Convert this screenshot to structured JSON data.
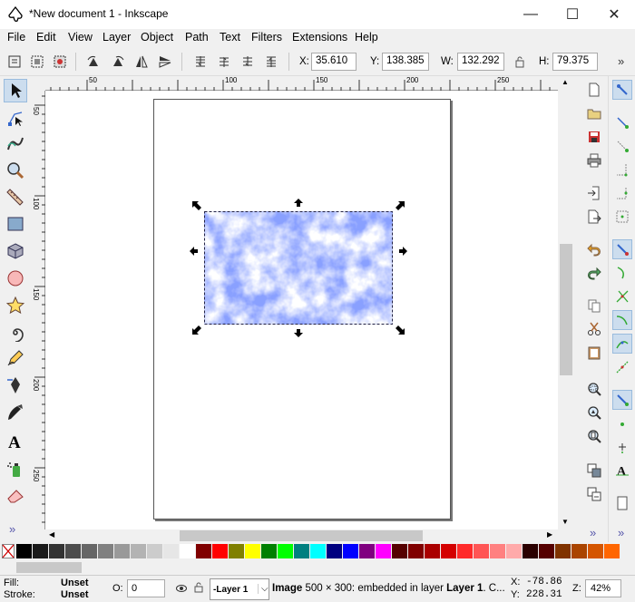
{
  "window": {
    "title": "*New document 1 - Inkscape",
    "minimize": "—",
    "maximize": "☐",
    "close": "✕"
  },
  "menu": [
    "File",
    "Edit",
    "View",
    "Layer",
    "Object",
    "Path",
    "Text",
    "Filters",
    "Extensions",
    "Help"
  ],
  "coords": {
    "x_label": "X:",
    "x_value": "35.610",
    "y_label": "Y:",
    "y_value": "138.385",
    "w_label": "W:",
    "w_value": "132.292",
    "h_label": "H:",
    "h_value": "79.375"
  },
  "ruler": {
    "h_ticks": [
      "50",
      "100",
      "150",
      "200",
      "250"
    ],
    "v_ticks": [
      "50",
      "100",
      "150",
      "200",
      "250"
    ]
  },
  "more": "»",
  "palette_colors": [
    "#000000",
    "#1a1a1a",
    "#333333",
    "#4d4d4d",
    "#666666",
    "#808080",
    "#999999",
    "#b3b3b3",
    "#cccccc",
    "#e6e6e6",
    "#ffffff",
    "#800000",
    "#ff0000",
    "#808000",
    "#ffff00",
    "#008000",
    "#00ff00",
    "#008080",
    "#00ffff",
    "#000080",
    "#0000ff",
    "#800080",
    "#ff00ff",
    "#550000",
    "#800000",
    "#aa0000",
    "#d40000",
    "#ff2a2a",
    "#ff5555",
    "#ff8080",
    "#ffaaaa",
    "#2b0000",
    "#550000",
    "#803300",
    "#aa4400",
    "#d45500",
    "#ff6600"
  ],
  "status": {
    "fill_label": "Fill:",
    "fill_value": "Unset",
    "stroke_label": "Stroke:",
    "stroke_value": "Unset",
    "opacity_label": "O:",
    "opacity_value": "0",
    "layer": "-Layer 1",
    "message_bold": "Image",
    "message": " 500 × 300: embedded in layer ",
    "message_layer": "Layer 1",
    "message_tail": ". C...",
    "cx_label": "X:",
    "cx": "-78.86",
    "cy_label": "Y:",
    "cy": "228.31",
    "zoom_label": "Z:",
    "zoom": "42%"
  }
}
